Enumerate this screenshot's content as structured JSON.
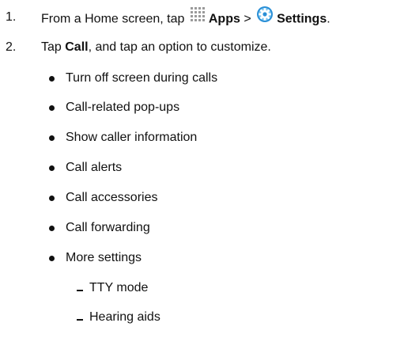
{
  "steps": [
    {
      "number": "1.",
      "text_before": "From a Home screen, tap",
      "apps_label": "Apps",
      "separator": ">",
      "settings_label": "Settings",
      "end_punct": ".",
      "apps_icon": "apps-grid-icon",
      "settings_icon": "settings-gear-icon"
    },
    {
      "number": "2.",
      "text_before": "Tap",
      "call_label": "Call",
      "text_after": ", and tap an option to customize."
    }
  ],
  "options": [
    "Turn off screen during calls",
    "Call-related pop-ups",
    "Show caller information",
    "Call alerts",
    "Call accessories",
    "Call forwarding",
    "More settings"
  ],
  "more_settings_items": [
    "TTY mode",
    "Hearing aids"
  ],
  "colors": {
    "text": "#111111",
    "settings_icon_blue": "#2a8fd6"
  }
}
